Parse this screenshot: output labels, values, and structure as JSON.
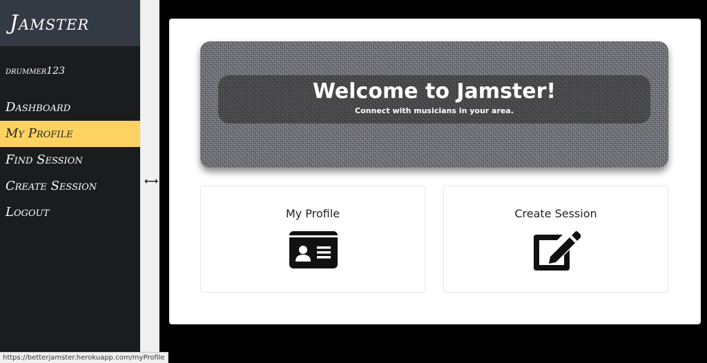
{
  "sidebar": {
    "brand": "Jamster",
    "username": "drummer123",
    "items": [
      {
        "label": "Dashboard",
        "active": false
      },
      {
        "label": "My Profile",
        "active": true
      },
      {
        "label": "Find Session",
        "active": false
      },
      {
        "label": "Create Session",
        "active": false
      },
      {
        "label": "Logout",
        "active": false
      }
    ],
    "active_color": "#fdd261"
  },
  "banner": {
    "title": "Welcome to Jamster!",
    "subtitle": "Connect with musicians in your area."
  },
  "tiles": [
    {
      "label": "My Profile",
      "icon": "id-card-icon"
    },
    {
      "label": "Create Session",
      "icon": "edit-icon"
    }
  ],
  "splitter": {
    "icon": "resize-horizontal-icon"
  },
  "status_bar": {
    "url": "https://betterjamster.herokuapp.com/myProfile"
  }
}
